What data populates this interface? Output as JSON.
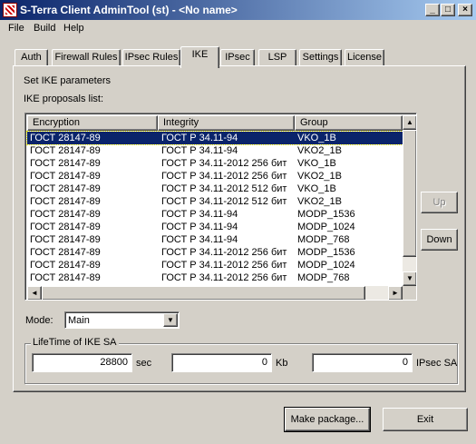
{
  "window": {
    "title": "S-Terra Client AdminTool (st) - <No name>",
    "minimize": "_",
    "maximize": "□",
    "close": "×"
  },
  "menu": [
    "File",
    "Build",
    "Help"
  ],
  "tabs": [
    "Auth",
    "Firewall Rules",
    "IPsec Rules",
    "IKE",
    "IPsec",
    "LSP",
    "Settings",
    "License"
  ],
  "active_tab": "IKE",
  "ike": {
    "section_title": "Set IKE parameters",
    "proposals_label": "IKE proposals list:",
    "columns": [
      "Encryption",
      "Integrity",
      "Group"
    ],
    "rows": [
      [
        "ГОСТ 28147-89",
        "ГОСТ Р 34.11-94",
        "VKO_1B"
      ],
      [
        "ГОСТ 28147-89",
        "ГОСТ Р 34.11-94",
        "VKO2_1B"
      ],
      [
        "ГОСТ 28147-89",
        "ГОСТ Р 34.11-2012 256 бит",
        "VKO_1B"
      ],
      [
        "ГОСТ 28147-89",
        "ГОСТ Р 34.11-2012 256 бит",
        "VKO2_1B"
      ],
      [
        "ГОСТ 28147-89",
        "ГОСТ Р 34.11-2012 512 бит",
        "VKO_1B"
      ],
      [
        "ГОСТ 28147-89",
        "ГОСТ Р 34.11-2012 512 бит",
        "VKO2_1B"
      ],
      [
        "ГОСТ 28147-89",
        "ГОСТ Р 34.11-94",
        "MODP_1536"
      ],
      [
        "ГОСТ 28147-89",
        "ГОСТ Р 34.11-94",
        "MODP_1024"
      ],
      [
        "ГОСТ 28147-89",
        "ГОСТ Р 34.11-94",
        "MODP_768"
      ],
      [
        "ГОСТ 28147-89",
        "ГОСТ Р 34.11-2012 256 бит",
        "MODP_1536"
      ],
      [
        "ГОСТ 28147-89",
        "ГОСТ Р 34.11-2012 256 бит",
        "MODP_1024"
      ],
      [
        "ГОСТ 28147-89",
        "ГОСТ Р 34.11-2012 256 бит",
        "MODP_768"
      ]
    ],
    "selected_row": 0,
    "up_label": "Up",
    "down_label": "Down",
    "mode_label": "Mode:",
    "mode_value": "Main",
    "lifetime": {
      "legend": "LifeTime of IKE SA",
      "sec_value": "28800",
      "sec_unit": "sec",
      "kb_value": "0",
      "kb_unit": "Kb",
      "ipsec_value": "0",
      "ipsec_unit": "IPsec SA"
    }
  },
  "footer": {
    "make_package": "Make package...",
    "exit": "Exit"
  },
  "colors": {
    "face": "#d4d0c8",
    "title_active": "#0a246a",
    "selection": "#0a246a"
  },
  "icons": {
    "app": "s-terra-app-icon",
    "scroll_up": "▲",
    "scroll_down": "▼",
    "scroll_left": "◄",
    "scroll_right": "►",
    "combo_drop": "▼"
  }
}
